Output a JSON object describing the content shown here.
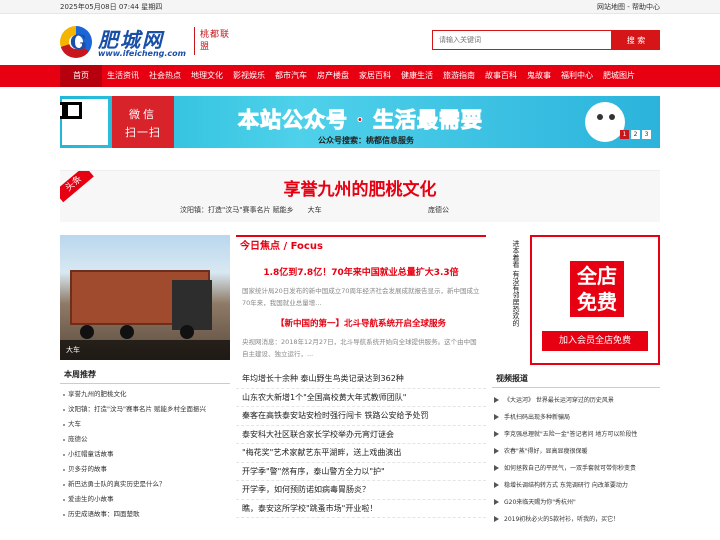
{
  "topbar": {
    "date": "2025年05月08日 07:44 星期四",
    "links": "网站地图 - 帮助中心"
  },
  "logo": {
    "name": "肥城网",
    "url": "www.ifeicheng.com",
    "tagline": "桃都联盟",
    "colors": {
      "blue": "#1a4fa8",
      "red": "#c8161d",
      "yellow": "#f4b400"
    }
  },
  "search": {
    "placeholder": "请输入关键词",
    "button": "搜 索"
  },
  "nav": {
    "items": [
      "首页",
      "生活资讯",
      "社会热点",
      "地理文化",
      "影视娱乐",
      "都市汽车",
      "房产楼盘",
      "家居百科",
      "健康生活",
      "旅游指南",
      "故事百科",
      "鬼故事",
      "福利中心",
      "肥城图片"
    ],
    "color": "#e60012"
  },
  "banner": {
    "wechat_line1": "微信",
    "wechat_line2": "扫一扫",
    "slogan_a": "本站公众号 · ",
    "slogan_b": "生活最需要",
    "wechat_id": "公众号搜索：桃都信息服务",
    "pages": [
      "1",
      "2",
      "3"
    ]
  },
  "headline": {
    "ribbon": "头条",
    "title": "享誉九州的肥桃文化",
    "subs": [
      "汶阳镇：打造\"汶马\"赛事名片 赋能乡",
      "大车"
    ],
    "sub3": "庞德公"
  },
  "feature": {
    "caption": "大车"
  },
  "weekly": {
    "title": "本周推荐",
    "items": [
      "享誉九州的肥桃文化",
      "汶阳镇：打造\"汶马\"赛事名片 赋能乡村全面振兴",
      "大车",
      "庞德公",
      "小红帽童话故事",
      "贝多芬的故事",
      "新巴达勇士队的真实历史是什么？",
      "爱迪生的小故事",
      "历史成语故事：四面楚歌"
    ]
  },
  "focus": {
    "title": "今日焦点 / Focus",
    "lead1": "1.8亿到7.8亿！70年来中国就业总量扩大3.3倍",
    "desc1": "国家统计局20日发布的新中国成立70周年经济社会发展成就报告显示，新中国成立70年来，我国就业总量增...",
    "lead2": "【新中国的第一】北斗导航系统开启全球服务",
    "desc2": "央视网消息：2018年12月27日，北斗导航系统开始向全球提供服务。这个由中国自主建设、独立运行，...",
    "items": [
      "年均增长十余种 泰山野生鸟类记录达到362种",
      "山东农大新增1个\"全国高校黄大年式教师团队\"",
      "秦客在高铁泰安站安检时强行闯卡 铁路公安给予处罚",
      "泰安科大社区联合家长学校举办元宵灯谜会",
      "\"梅花奖\"艺术家献艺东平湖畔，送上戏曲演出",
      "开学季\"警\"然有序，泰山警方全力以\"护\"",
      "开学季，如何预防诺如病毒胃肠炎？",
      "瞧，泰安这所学校\"跳蚤市场\"开业啦！"
    ]
  },
  "vertical": {
    "text": "进本着看 有没有邻居恐欢的"
  },
  "promo": {
    "big": "全店免费",
    "button": "加入会员全店免费",
    "color": "#e60012"
  },
  "video": {
    "title": "视频报道",
    "items": [
      "《大运河》 世界最长运河穿过的历史风景",
      "手机扫码出现多种新骗局",
      "李克强总理就\"五险一金\"答记者问 地方可以阶段性",
      "农春\"蒸\"得好，显高显瘦很保暖",
      "如何拯救自己的平民气，一双手套就可带你秒变贵",
      "稳增长调结构转方式 东莞调研行 向改革要动力",
      "G20来临天赐为你\"秀杭州\"",
      "2019初秋必火的5款衬衫，听我的，买它！"
    ]
  }
}
